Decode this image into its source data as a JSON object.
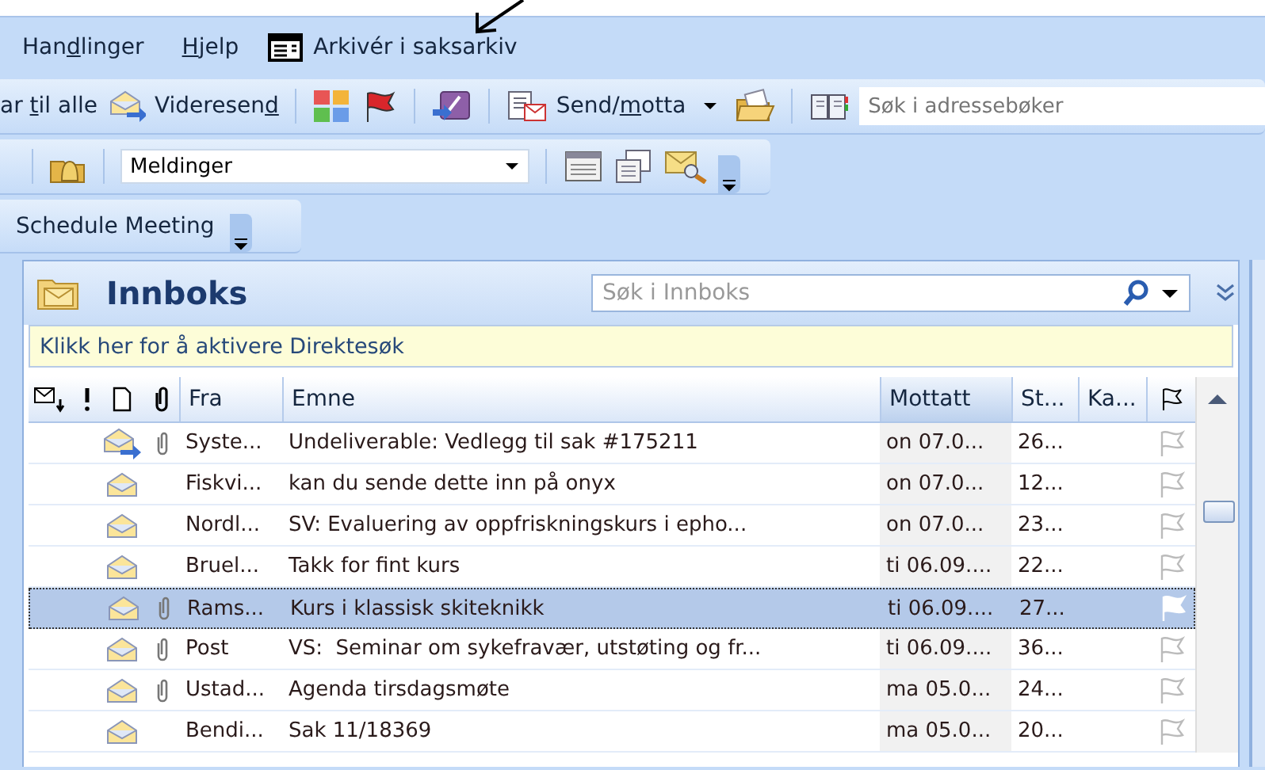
{
  "menu": [
    {
      "kind": "menu",
      "label": {
        "before": "Han",
        "key": "d",
        "after": "linger"
      }
    },
    {
      "kind": "menu",
      "label": {
        "key": "H",
        "after": "jelp"
      }
    },
    {
      "kind": "command",
      "label": "Arkivér i saksarkiv"
    }
  ],
  "toolbar_1": {
    "reply_all": {
      "label": {
        "before": "ar ",
        "key": "t",
        "after": "il alle"
      }
    },
    "forward": {
      "label": {
        "before": "Videresen",
        "key": "d"
      }
    },
    "send_receive": {
      "label": {
        "before": "Send/",
        "key": "m",
        "after": "otta"
      }
    },
    "address_search": {
      "placeholder": "Søk i adressebøker"
    }
  },
  "toolbar_2": {
    "view_combo": {
      "value": "Meldinger"
    }
  },
  "toolbar_3": {
    "schedule_meeting": {
      "label": "Schedule Meeting"
    }
  },
  "inbox": {
    "title": "Innboks",
    "search": {
      "placeholder": "Søk i Innboks"
    },
    "instant_search_bar": "Klikk her for å aktivere Direktesøk",
    "columns": [
      {
        "label": "Fra",
        "sorted": false
      },
      {
        "label": "Emne",
        "sorted": false
      },
      {
        "label": "Mottatt",
        "sorted": true
      },
      {
        "label": "St...",
        "sorted": false
      },
      {
        "label": "Ka...",
        "sorted": false
      }
    ],
    "rows": [
      {
        "kind": "forwarded",
        "attachment": true,
        "from": "Syste...",
        "subject": "Undeliverable: Vedlegg til sak #175211",
        "received": "on 07.0...",
        "size": "26...",
        "selected": false
      },
      {
        "kind": "read",
        "attachment": false,
        "from": "Fiskvi...",
        "subject": "kan du sende dette inn på onyx",
        "received": "on 07.0...",
        "size": "12...",
        "selected": false
      },
      {
        "kind": "read",
        "attachment": false,
        "from": "Nordl...",
        "subject": "SV: Evaluering av oppfriskningskurs i epho...",
        "received": "on 07.0...",
        "size": "23...",
        "selected": false
      },
      {
        "kind": "read",
        "attachment": false,
        "from": "Bruel...",
        "subject": "Takk for fint kurs",
        "received": "ti 06.09....",
        "size": "22...",
        "selected": false
      },
      {
        "kind": "read",
        "attachment": true,
        "from": "Rams...",
        "subject": "Kurs i klassisk skiteknikk",
        "received": "ti 06.09....",
        "size": "27...",
        "selected": true
      },
      {
        "kind": "read",
        "attachment": true,
        "from": "Post",
        "subject": "VS:  Seminar om sykefravær, utstøting og fr...",
        "received": "ti 06.09....",
        "size": "36...",
        "selected": false
      },
      {
        "kind": "read",
        "attachment": true,
        "from": "Ustad...",
        "subject": "Agenda tirsdagsmøte",
        "received": "ma 05.0...",
        "size": "24...",
        "selected": false
      },
      {
        "kind": "read",
        "attachment": false,
        "from": "Bendi...",
        "subject": "Sak 11/18369",
        "received": "ma 05.0...",
        "size": "20...",
        "selected": false
      }
    ]
  }
}
